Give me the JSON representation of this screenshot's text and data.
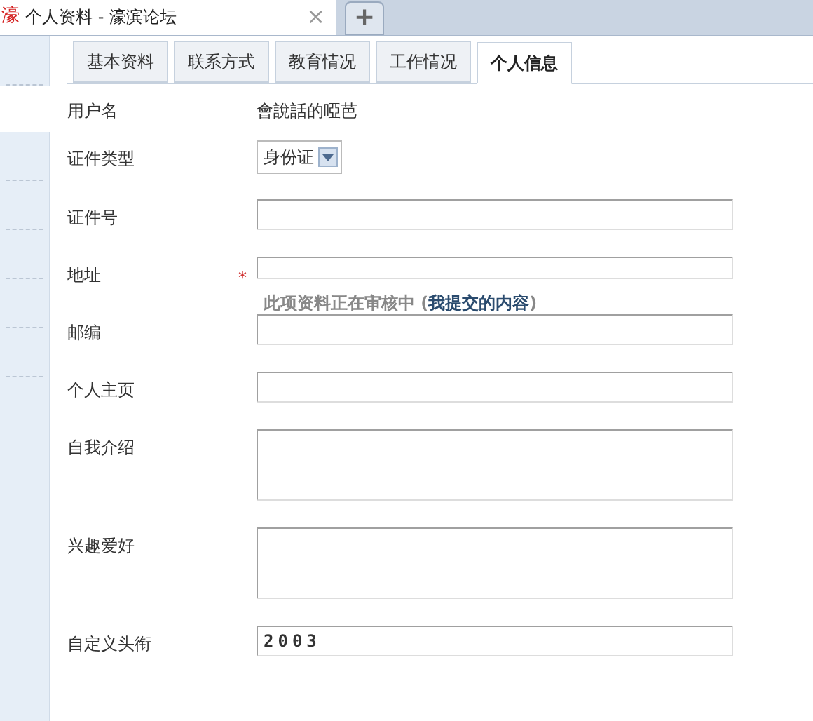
{
  "browser_tab": {
    "favicon": "濠",
    "title": "个人资料 - 濠滨论坛",
    "close": "×",
    "new_tab": "+"
  },
  "sidebar": {
    "items": [
      {
        "selected": false
      },
      {
        "selected": true
      },
      {
        "selected": false
      },
      {
        "selected": false
      },
      {
        "selected": false
      },
      {
        "selected": false
      },
      {
        "selected": false
      }
    ]
  },
  "tabs": [
    {
      "label": "基本资料",
      "selected": false
    },
    {
      "label": "联系方式",
      "selected": false
    },
    {
      "label": "教育情况",
      "selected": false
    },
    {
      "label": "工作情况",
      "selected": false
    },
    {
      "label": "个人信息",
      "selected": true
    }
  ],
  "form": [
    {
      "kind": "text",
      "label": "用户名",
      "value": "會說話的啞芭"
    },
    {
      "kind": "select",
      "label": "证件类型",
      "value": "身份证"
    },
    {
      "kind": "input",
      "label": "证件号"
    },
    {
      "kind": "input",
      "label": "地址",
      "required_mark": "*",
      "note": "此项资料正在审核中 (",
      "note_link": "我提交的内容",
      "note_end": ")"
    },
    {
      "kind": "input",
      "label": "邮编"
    },
    {
      "kind": "input",
      "label": "个人主页"
    },
    {
      "kind": "textarea",
      "label": "自我介绍"
    },
    {
      "kind": "textarea",
      "label": "兴趣爱好"
    },
    {
      "kind": "input",
      "label": "自定义头衔",
      "value": "2003"
    }
  ]
}
